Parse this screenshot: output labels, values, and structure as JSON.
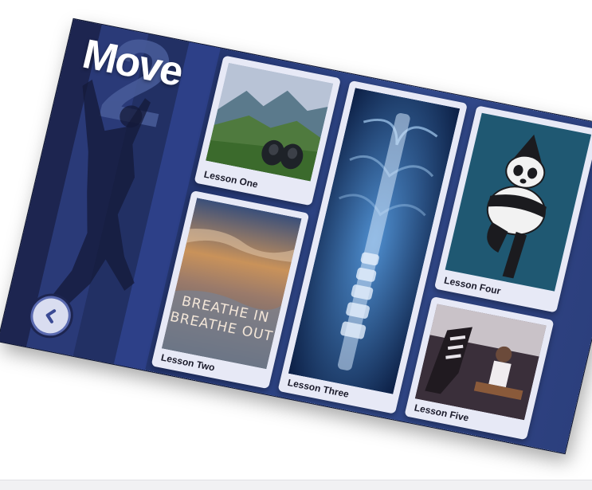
{
  "screen": {
    "title": "Move",
    "number": "2",
    "back_icon": "chevron-left-icon"
  },
  "lessons": [
    {
      "label": "Lesson One",
      "image": "mountain-hiking-photo"
    },
    {
      "label": "Lesson Two",
      "image": "sunset-sky-photo",
      "overlay_text": [
        "BREATHE IN",
        "BREATHE OUT"
      ]
    },
    {
      "label": "Lesson Three",
      "image": "spine-xray-photo"
    },
    {
      "label": "Lesson Four",
      "image": "yoga-panda-illustration"
    },
    {
      "label": "Lesson Five",
      "image": "gym-workout-photo"
    }
  ],
  "colors": {
    "accent": "#324a8c",
    "card": "#e7e9f6",
    "panda_bg": "#1f5872"
  }
}
